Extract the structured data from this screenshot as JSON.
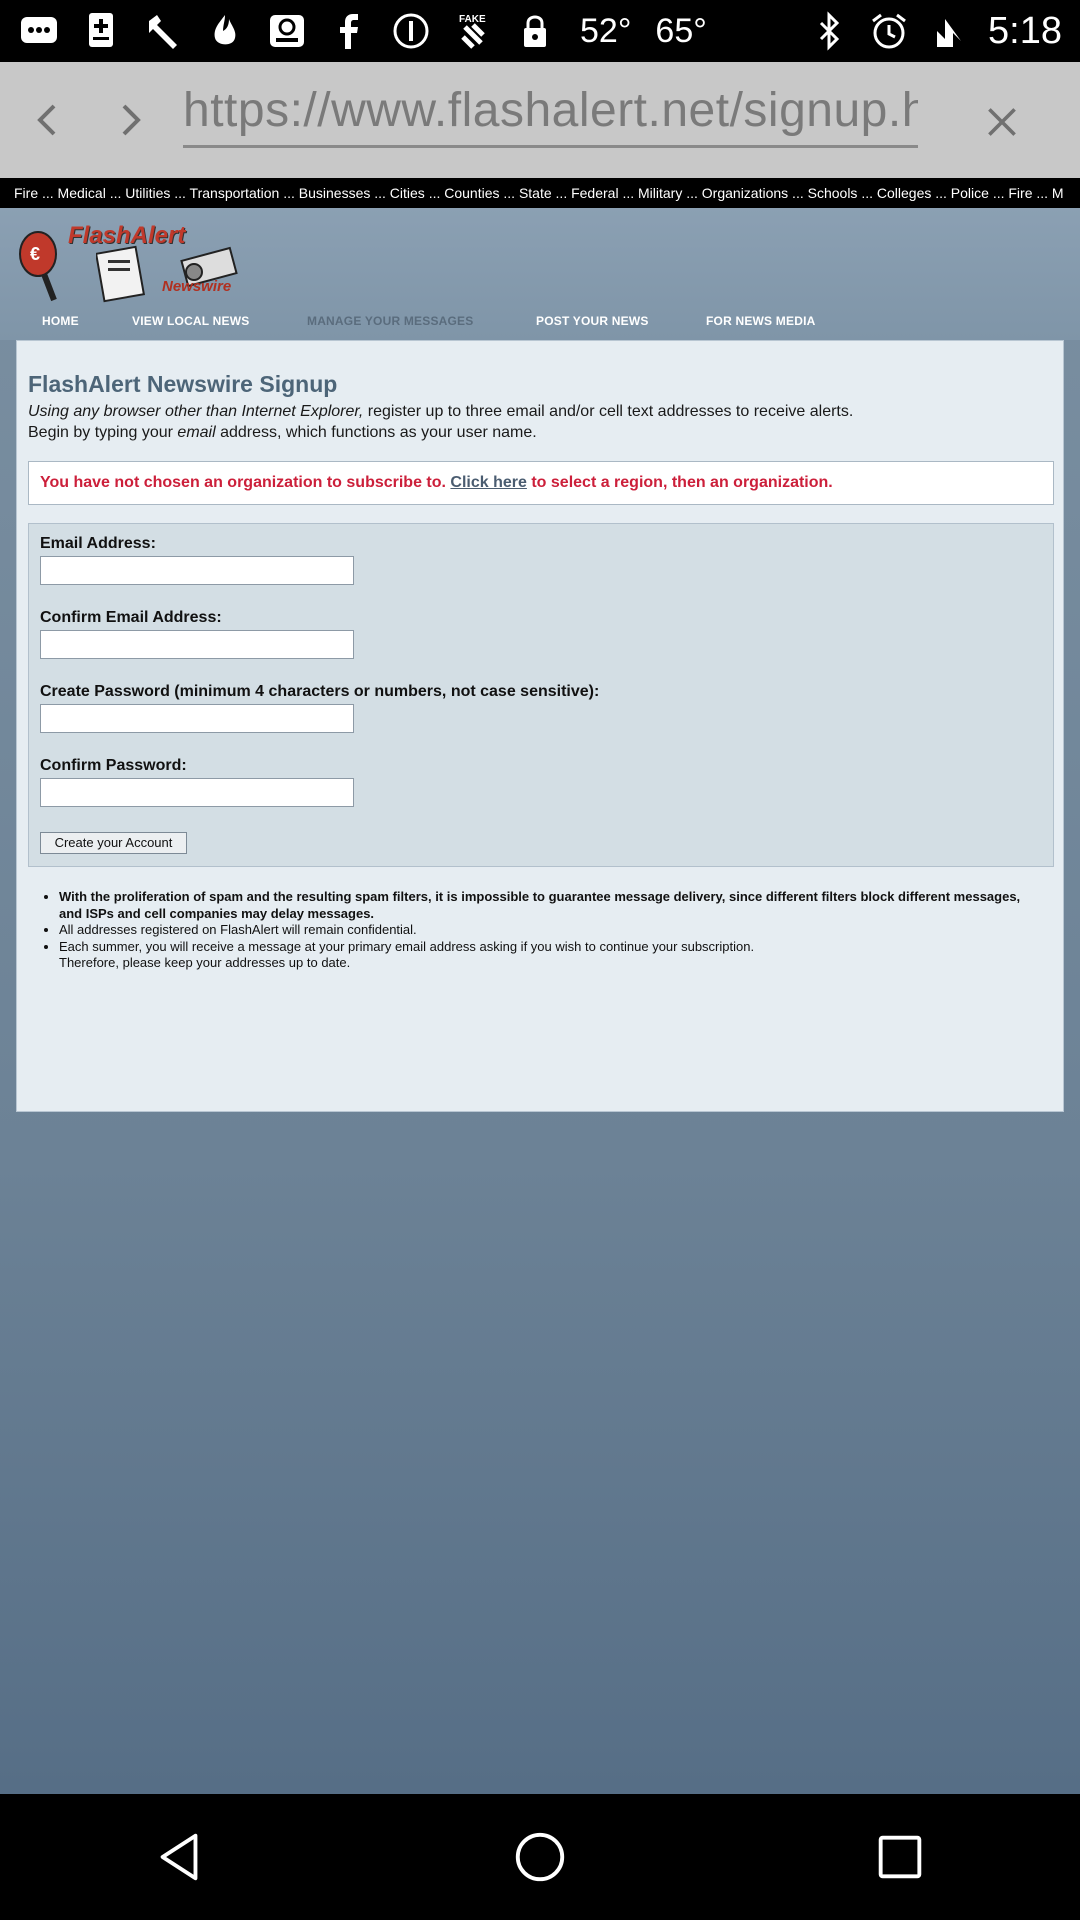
{
  "status_bar": {
    "temp1": "52°",
    "temp2": "65°",
    "time": "5:18",
    "icons": [
      "chat-bubble-icon",
      "plus-card-icon",
      "wrench-icon",
      "flame-icon",
      "photo-icon",
      "facebook-icon",
      "info-icon",
      "fake-gps-icon",
      "lock-icon",
      "bluetooth-icon",
      "alarm-icon",
      "signal-icon"
    ]
  },
  "browser": {
    "url": "https://www.flashalert.net/signup.html"
  },
  "ticker": {
    "text": "Fire ... Medical ... Utilities ... Transportation ... Businesses ... Cities ... Counties ... State ... Federal ... Military ... Organizations ... Schools ... Colleges ... Police ... Fire ... M"
  },
  "site": {
    "logo_title": "FlashAlert",
    "logo_sub": "Newswire",
    "nav": [
      "HOME",
      "VIEW LOCAL NEWS",
      "MANAGE YOUR MESSAGES",
      "POST YOUR NEWS",
      "FOR NEWS MEDIA"
    ]
  },
  "page": {
    "title": "FlashAlert Newswire Signup",
    "intro_italic": "Using any browser other than Internet Explorer,",
    "intro_rest": " register up to three email and/or cell text addresses to receive alerts.",
    "intro_line2_a": "Begin by typing your ",
    "intro_line2_em": "email",
    "intro_line2_b": " address, which functions as your user name.",
    "notice_a": "You have not chosen an organization to subscribe to. ",
    "notice_link": "Click here",
    "notice_b": " to select a region, then an organization."
  },
  "form": {
    "email_label": "Email Address:",
    "email_value": "",
    "confirm_email_label": "Confirm Email Address:",
    "confirm_email_value": "",
    "password_label": "Create Password (minimum 4 characters or numbers, not case sensitive):",
    "password_value": "",
    "confirm_password_label": "Confirm Password:",
    "confirm_password_value": "",
    "submit_label": "Create your Account"
  },
  "notes": {
    "item1": "With the proliferation of spam and the resulting spam filters, it is impossible to guarantee message delivery, since different filters block different messages, and ISPs and cell companies may delay messages.",
    "item2": "All addresses registered on FlashAlert will remain confidential.",
    "item3": "Each summer, you will receive a message at your primary email address asking if you wish to continue your subscription.",
    "item3b": "Therefore, please keep your addresses up to date."
  },
  "colors": {
    "notice_red": "#cc1f3a",
    "title_blue": "#4d6578",
    "page_bg": "#e6edf2"
  }
}
